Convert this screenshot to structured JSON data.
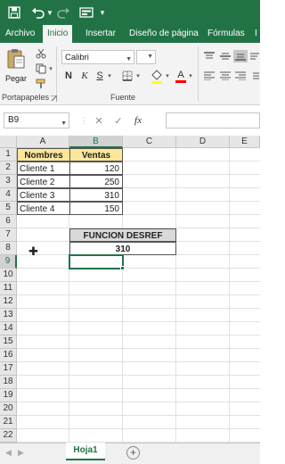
{
  "colors": {
    "brand": "#217346",
    "header_fill": "#fde79a",
    "func_header_fill": "#d9d9d9"
  },
  "tabs": [
    {
      "label": "Archivo",
      "active": false
    },
    {
      "label": "Inicio",
      "active": true
    },
    {
      "label": "Insertar",
      "active": false
    },
    {
      "label": "Diseño de página",
      "active": false
    },
    {
      "label": "Fórmulas",
      "active": false
    },
    {
      "label": "I",
      "active": false
    }
  ],
  "ribbon": {
    "paste_label": "Pegar",
    "font_name": "Calibri",
    "group_clipboard": "Portapapeles",
    "group_font": "Fuente",
    "icons": [
      "clipboard-icon",
      "cut-icon",
      "copy-icon",
      "format-painter-icon",
      "bold-icon",
      "italic-icon",
      "underline-icon",
      "borders-icon",
      "fill-color-icon",
      "font-color-icon",
      "align-top-icon",
      "align-middle-icon",
      "align-bottom-icon",
      "align-left-icon",
      "align-center-icon",
      "align-right-icon"
    ]
  },
  "formula_bar": {
    "name_box": "B9",
    "cancel_symbol": "✕",
    "enter_symbol": "✓",
    "fx_symbol": "fx",
    "value": ""
  },
  "columns": [
    "A",
    "B",
    "C",
    "D",
    "E"
  ],
  "rows": [
    "1",
    "2",
    "3",
    "4",
    "5",
    "6",
    "7",
    "8",
    "9",
    "10",
    "11",
    "12",
    "13",
    "14",
    "15",
    "16",
    "17",
    "18",
    "19",
    "20",
    "21",
    "22"
  ],
  "table": {
    "headers": [
      "Nombres",
      "Ventas"
    ],
    "rows": [
      {
        "name": "Cliente 1",
        "value": "120"
      },
      {
        "name": "Cliente 2",
        "value": "250"
      },
      {
        "name": "Cliente 3",
        "value": "310"
      },
      {
        "name": "Cliente 4",
        "value": "150"
      }
    ]
  },
  "function_box": {
    "title": "FUNCION DESREF",
    "result": "310"
  },
  "selected_cell": "B9",
  "sheets": [
    {
      "name": "Hoja1",
      "active": true
    }
  ],
  "add_sheet_symbol": "+"
}
